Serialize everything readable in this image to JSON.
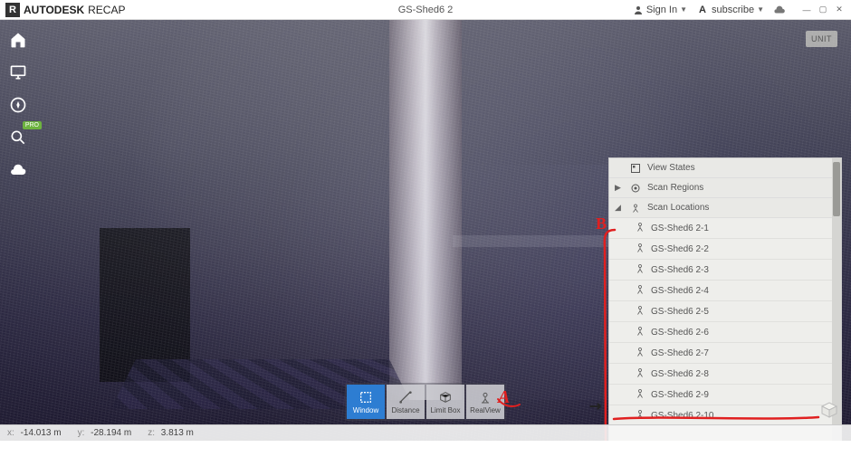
{
  "titlebar": {
    "brand_prefix": "AUTODESK",
    "brand_name": "RECAP",
    "project_name": "GS-Shed6 2",
    "signin_label": "Sign In",
    "subscribe_label": "subscribe"
  },
  "left_tools": {
    "pro_badge": "PRO"
  },
  "unit_chip": {
    "label": "UNIT"
  },
  "coords": {
    "x_label": "x:",
    "x_value": "-14.013 m",
    "y_label": "y:",
    "y_value": "-28.194 m",
    "z_label": "z:",
    "z_value": "3.813 m"
  },
  "bottom_tools": {
    "window": "Window",
    "distance": "Distance",
    "limitbox": "Limit Box",
    "realview": "RealView"
  },
  "panel": {
    "sections": {
      "view_states": "View States",
      "scan_regions": "Scan Regions",
      "scan_locations": "Scan Locations"
    },
    "scans": [
      "GS-Shed6 2-1",
      "GS-Shed6 2-2",
      "GS-Shed6 2-3",
      "GS-Shed6 2-4",
      "GS-Shed6 2-5",
      "GS-Shed6 2-6",
      "GS-Shed6 2-7",
      "GS-Shed6 2-8",
      "GS-Shed6 2-9",
      "GS-Shed6 2-10"
    ]
  },
  "annotations": {
    "a": "A",
    "b": "B"
  }
}
